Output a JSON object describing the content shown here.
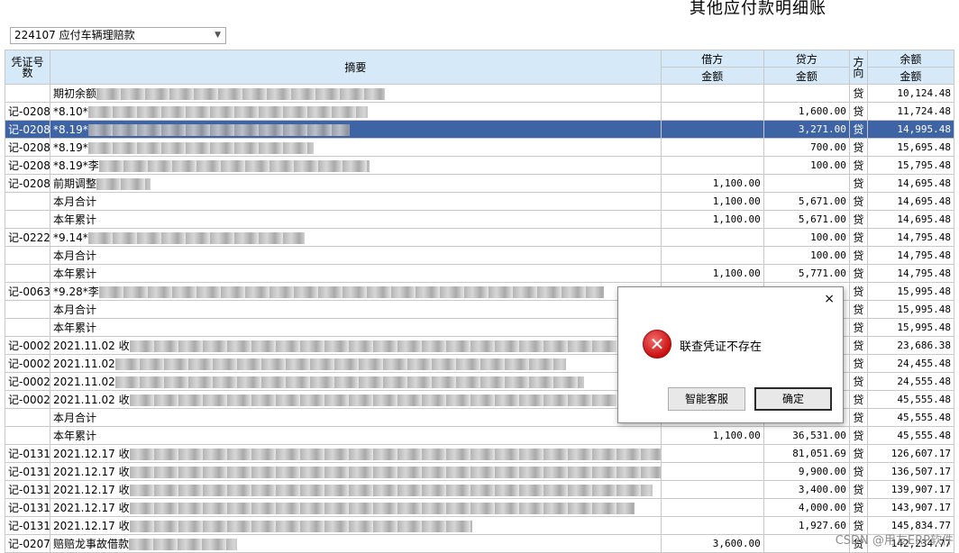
{
  "title": "其他应付款明细账",
  "account": "224107 应付车辆理赔款",
  "columns": {
    "voucher": "凭证号数",
    "summary": "摘要",
    "debit": "借方",
    "credit": "贷方",
    "direction": "方向",
    "balance": "余额",
    "amount": "金额"
  },
  "rows": [
    {
      "voucher": "",
      "summary": "期初余额",
      "debit": "",
      "credit": "",
      "dir": "贷",
      "balance": "10,124.48"
    },
    {
      "voucher": "记-0208",
      "summary": "*8.10*",
      "debit": "",
      "credit": "1,600.00",
      "dir": "贷",
      "balance": "11,724.48"
    },
    {
      "voucher": "记-0208",
      "summary": "*8.19*",
      "debit": "",
      "credit": "3,271.00",
      "dir": "贷",
      "balance": "14,995.48",
      "selected": true
    },
    {
      "voucher": "记-0208",
      "summary": "*8.19*",
      "debit": "",
      "credit": "700.00",
      "dir": "贷",
      "balance": "15,695.48"
    },
    {
      "voucher": "记-0208",
      "summary": "*8.19*李",
      "debit": "",
      "credit": "100.00",
      "dir": "贷",
      "balance": "15,795.48"
    },
    {
      "voucher": "记-0208",
      "summary": "前期调整",
      "debit": "1,100.00",
      "credit": "",
      "dir": "贷",
      "balance": "14,695.48"
    },
    {
      "voucher": "",
      "summary": "本月合计",
      "debit": "1,100.00",
      "credit": "5,671.00",
      "dir": "贷",
      "balance": "14,695.48"
    },
    {
      "voucher": "",
      "summary": "本年累计",
      "debit": "1,100.00",
      "credit": "5,671.00",
      "dir": "贷",
      "balance": "14,695.48"
    },
    {
      "voucher": "记-0222",
      "summary": "*9.14*",
      "debit": "",
      "credit": "100.00",
      "dir": "贷",
      "balance": "14,795.48"
    },
    {
      "voucher": "",
      "summary": "本月合计",
      "debit": "",
      "credit": "100.00",
      "dir": "贷",
      "balance": "14,795.48"
    },
    {
      "voucher": "",
      "summary": "本年累计",
      "debit": "1,100.00",
      "credit": "5,771.00",
      "dir": "贷",
      "balance": "14,795.48"
    },
    {
      "voucher": "记-0063",
      "summary": "*9.28*李",
      "debit": "",
      "credit": "",
      "dir": "贷",
      "balance": "15,995.48"
    },
    {
      "voucher": "",
      "summary": "本月合计",
      "debit": "",
      "credit": "",
      "dir": "贷",
      "balance": "15,995.48"
    },
    {
      "voucher": "",
      "summary": "本年累计",
      "debit": "",
      "credit": "",
      "dir": "贷",
      "balance": "15,995.48"
    },
    {
      "voucher": "记-0002",
      "summary": "2021.11.02 收",
      "debit": "",
      "credit": "",
      "dir": "贷",
      "balance": "23,686.38"
    },
    {
      "voucher": "记-0002",
      "summary": "2021.11.02",
      "debit": "",
      "credit": "",
      "dir": "贷",
      "balance": "24,455.48"
    },
    {
      "voucher": "记-0002",
      "summary": "2021.11.02",
      "debit": "",
      "credit": "",
      "dir": "贷",
      "balance": "24,555.48"
    },
    {
      "voucher": "记-0002",
      "summary": "2021.11.02 收",
      "debit": "",
      "credit": "",
      "dir": "贷",
      "balance": "45,555.48"
    },
    {
      "voucher": "",
      "summary": "本月合计",
      "debit": "",
      "credit": "",
      "dir": "贷",
      "balance": "45,555.48"
    },
    {
      "voucher": "",
      "summary": "本年累计",
      "debit": "1,100.00",
      "credit": "36,531.00",
      "dir": "贷",
      "balance": "45,555.48"
    },
    {
      "voucher": "记-0131",
      "summary": "2021.12.17 收",
      "debit": "",
      "credit": "81,051.69",
      "dir": "贷",
      "balance": "126,607.17"
    },
    {
      "voucher": "记-0131",
      "summary": "2021.12.17 收",
      "debit": "",
      "credit": "9,900.00",
      "dir": "贷",
      "balance": "136,507.17"
    },
    {
      "voucher": "记-0131",
      "summary": "2021.12.17 收",
      "debit": "",
      "credit": "3,400.00",
      "dir": "贷",
      "balance": "139,907.17"
    },
    {
      "voucher": "记-0131",
      "summary": "2021.12.17 收",
      "debit": "",
      "credit": "4,000.00",
      "dir": "贷",
      "balance": "143,907.17"
    },
    {
      "voucher": "记-0131",
      "summary": "2021.12.17 收",
      "debit": "",
      "credit": "1,927.60",
      "dir": "贷",
      "balance": "145,834.77"
    },
    {
      "voucher": "记-0207",
      "summary": "赔赔龙事故借款",
      "debit": "3,600.00",
      "credit": "",
      "dir": "贷",
      "balance": "142,234.77"
    }
  ],
  "dialog": {
    "message": "联查凭证不存在",
    "help_button": "智能客服",
    "ok_button": "确定",
    "close_glyph": "×",
    "icon_glyph": "✕"
  },
  "watermark": "CSDN @用友ERP软件"
}
